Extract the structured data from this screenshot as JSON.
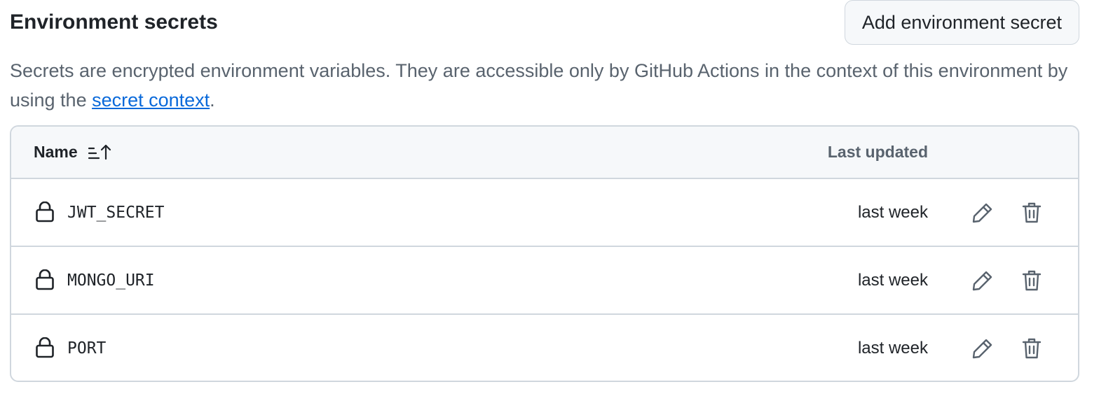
{
  "header": {
    "title": "Environment secrets",
    "add_button_label": "Add environment secret"
  },
  "description": {
    "text_before_link": "Secrets are encrypted environment variables. They are accessible only by GitHub Actions in the context of this environment by using the ",
    "link_text": "secret context",
    "text_after_link": "."
  },
  "table": {
    "columns": {
      "name": "Name",
      "last_updated": "Last updated"
    },
    "sort_icon": "sort-ascending-icon",
    "rows": [
      {
        "name": "JWT_SECRET",
        "updated": "last week",
        "icon": "lock-icon"
      },
      {
        "name": "MONGO_URI",
        "updated": "last week",
        "icon": "lock-icon"
      },
      {
        "name": "PORT",
        "updated": "last week",
        "icon": "lock-icon"
      }
    ]
  },
  "colors": {
    "text": "#1f2328",
    "muted": "#59636e",
    "link": "#0969da",
    "border": "#d0d7de",
    "header_bg": "#f6f8fa"
  }
}
